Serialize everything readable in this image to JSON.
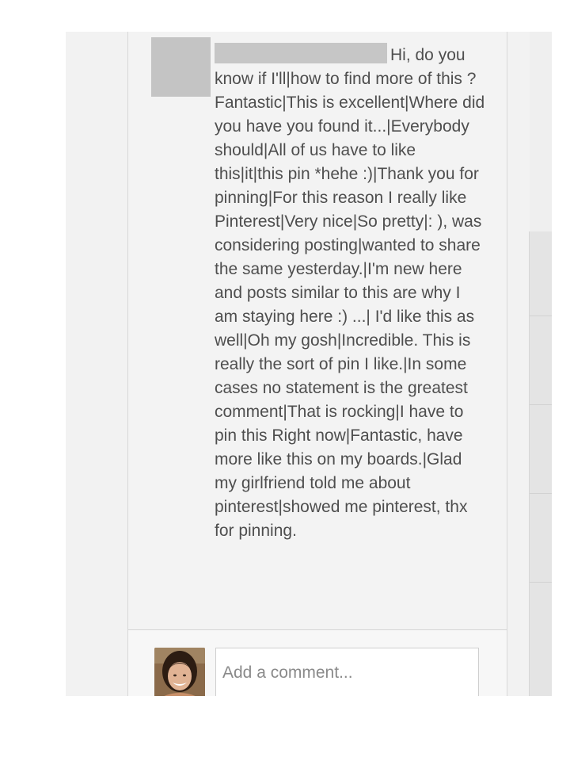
{
  "comment": {
    "author_name": "",
    "text": "Hi, do you know if I'll|how to find more of this ? Fantastic|This is excellent|Where did you have you found it...|Everybody should|All of us have to like this|it|this pin *hehe :)|Thank you for pinning|For this reason I really like Pinterest|Very nice|So pretty|: ), was considering posting|wanted to share the same yesterday.|I'm new here and posts similar to this are why I am staying here :) ...| I'd like this as well|Oh my gosh|Incredible. This is really the sort of pin I like.|In some cases no statement is the greatest comment|That is rocking|I have to pin this Right now|Fantastic, have more like this on my boards.|Glad my girlfriend told me about pinterest|showed me pinterest, thx for pinning."
  },
  "add_comment": {
    "placeholder": "Add a comment..."
  },
  "colors": {
    "card_background": "#f3f3f3",
    "text": "#4e4e4e",
    "redaction": "#c6c6c6"
  }
}
